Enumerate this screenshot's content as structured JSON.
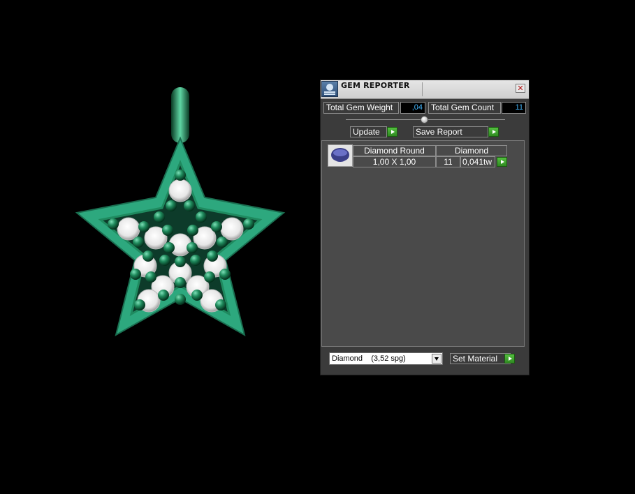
{
  "panel": {
    "title": "GEM REPORTER",
    "close_glyph": "✕",
    "total_weight_label": "Total Gem Weight",
    "total_weight_value": ",04",
    "total_count_label": "Total Gem Count",
    "total_count_value": "11",
    "update_label": "Update",
    "save_report_label": "Save Report",
    "gem_row": {
      "shape": "Diamond Round",
      "material": "Diamond",
      "size": "1,00 X 1,00",
      "count": "11",
      "weight": "0,041tw"
    },
    "material_select": {
      "value": "Diamond    (3,52 spg)"
    },
    "set_material_label": "Set Material"
  },
  "colors": {
    "background": "#000000",
    "panel_bg": "#3b3b3b",
    "value_text": "#44b8ff",
    "accent_green": "#3cae30",
    "pendant_green": "#2da87e"
  },
  "icons": {
    "title": "gem-reporter-icon",
    "close": "close-icon",
    "arrow": "play-arrow-icon",
    "thumb": "round-diamond-icon",
    "dropdown": "chevron-down-icon"
  }
}
